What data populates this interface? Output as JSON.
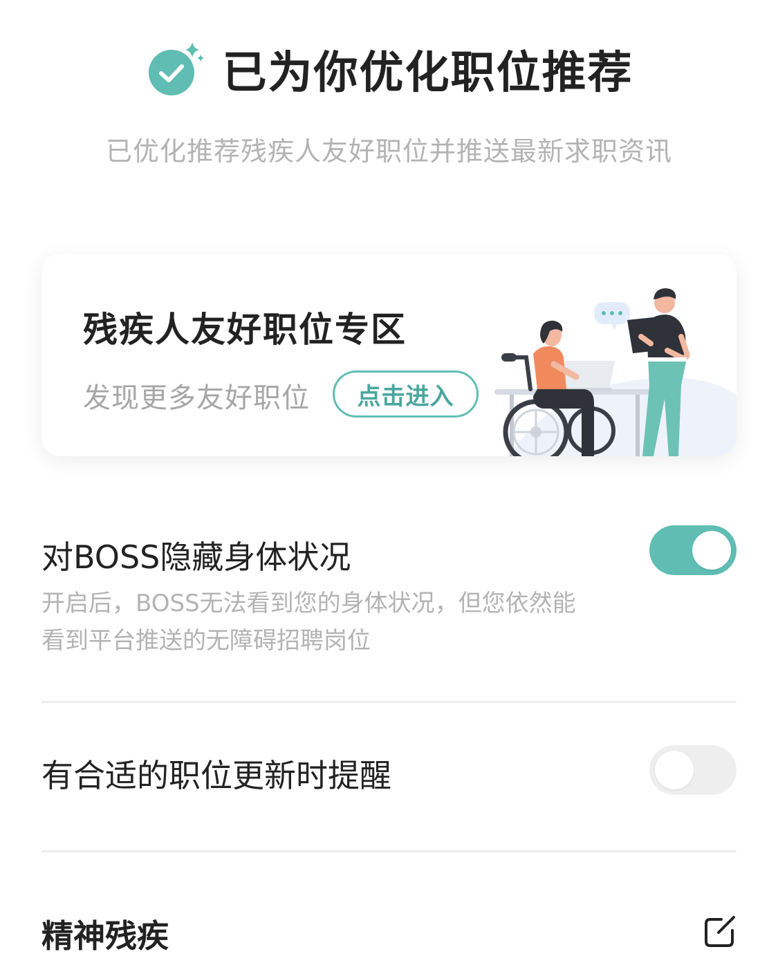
{
  "header": {
    "title": "已为你优化职位推荐",
    "subtitle": "已优化推荐残疾人友好职位并推送最新求职资讯",
    "icon": "check-circle-sparkle-icon"
  },
  "banner": {
    "title": "残疾人友好职位专区",
    "subtitle": "发现更多友好职位",
    "button_label": "点击进入"
  },
  "settings": {
    "hide_status": {
      "label": "对BOSS隐藏身体状况",
      "description_line1": "开启后，BOSS无法看到您的身体状况，但您依然能",
      "description_line2": "看到平台推送的无障碍招聘岗位",
      "enabled": true
    },
    "job_update_reminder": {
      "label": "有合适的职位更新时提醒",
      "enabled": false
    },
    "disability_type": {
      "label": "精神残疾",
      "icon": "edit-icon"
    }
  },
  "colors": {
    "accent": "#5fbdb3",
    "text_primary": "#222222",
    "text_secondary": "#b3b3b3",
    "toggle_off": "#eeeeee"
  }
}
